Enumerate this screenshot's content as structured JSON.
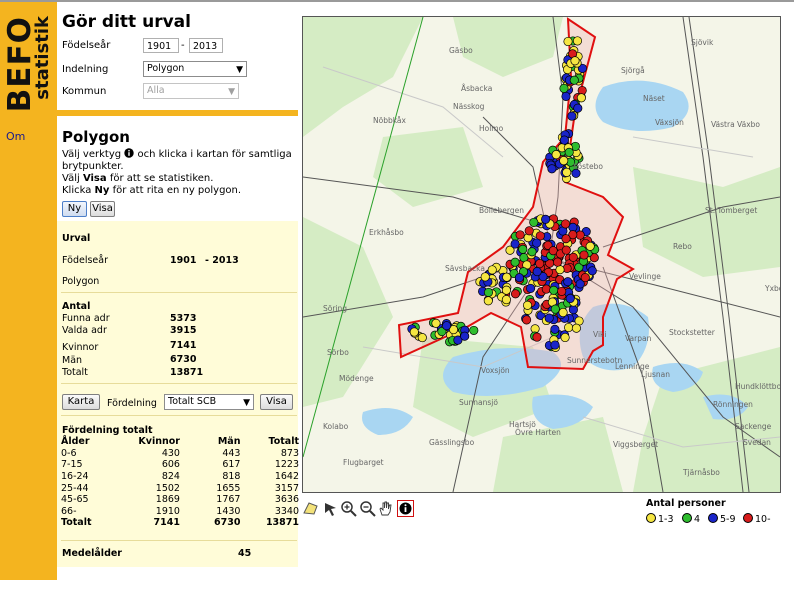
{
  "brand": {
    "main": "BEFO",
    "sub": "statistik"
  },
  "nav": {
    "om": "Om"
  },
  "selection_form": {
    "title": "Gör ditt urval",
    "birth_year_label": "Födelseår",
    "birth_from": "1901",
    "birth_to": "2013",
    "dash": "-",
    "division_label": "Indelning",
    "division_value": "Polygon",
    "municipality_label": "Kommun",
    "municipality_value": "Alla"
  },
  "polygon": {
    "title": "Polygon",
    "line1_pre": "Välj verktyg",
    "line1_post": "och klicka i kartan för samtliga brytpunkter.",
    "line2_pre": "Välj",
    "line2_bold": "Visa",
    "line2_post": "för att se statistiken.",
    "line3_pre": "Klicka",
    "line3_bold": "Ny",
    "line3_post": "för att rita en ny polygon.",
    "btn_new": "Ny",
    "btn_show": "Visa"
  },
  "stats": {
    "urval_heading": "Urval",
    "birth_label": "Födelseår",
    "birth_from": "1901",
    "birth_to": "- 2013",
    "division": "Polygon",
    "antal_heading": "Antal",
    "rows": [
      {
        "label": "Funna adr",
        "value": "5373"
      },
      {
        "label": "Valda adr",
        "value": "3915"
      },
      {
        "label": "Kvinnor",
        "value": "7141"
      },
      {
        "label": "Män",
        "value": "6730"
      },
      {
        "label": "Totalt",
        "value": "13871"
      }
    ],
    "karta_button": "Karta",
    "fordelning_label": "Fördelning",
    "fordelning_value": "Totalt SCB",
    "visa_button": "Visa"
  },
  "distribution": {
    "heading": "Fördelning totalt",
    "columns": [
      "Ålder",
      "Kvinnor",
      "Män",
      "Totalt"
    ],
    "rows": [
      [
        "0-6",
        "430",
        "443",
        "873"
      ],
      [
        "7-15",
        "606",
        "617",
        "1223"
      ],
      [
        "16-24",
        "824",
        "818",
        "1642"
      ],
      [
        "25-44",
        "1502",
        "1655",
        "3157"
      ],
      [
        "45-65",
        "1869",
        "1767",
        "3636"
      ],
      [
        "66-",
        "1910",
        "1430",
        "3340"
      ]
    ],
    "total": [
      "Totalt",
      "7141",
      "6730",
      "13871"
    ],
    "median_label": "Medelålder",
    "median_value": "45"
  },
  "map": {
    "places": [
      "Gäsbo",
      "Sjövik",
      "Sjörgå",
      "Åsbacka",
      "Näset",
      "Nässkog",
      "Nöbbkåx",
      "Holmo",
      "Växsjön",
      "Västra Växbo",
      "Köstebo",
      "Bollebergen",
      "Erkhåsbo",
      "St. Tomberget",
      "Sävsbacka",
      "Rebo",
      "Vevlinge",
      "Söring",
      "Stockstetter",
      "Yxbo",
      "Sörbo",
      "Varpan",
      "Viki",
      "Mödenge",
      "Sunnerstebotn",
      "Lenninge",
      "Voxsjön",
      "Ljusnan",
      "Hundklöttbo",
      "Sunnansjö",
      "Hartsjö",
      "Övre Harten",
      "Sackenge",
      "Gässlingsbo",
      "Kolabo",
      "Svedan",
      "Flugbarget",
      "Viggsberget",
      "Tjärnåsbo",
      "Rönningen"
    ]
  },
  "tools": [
    "polygon-draw-icon",
    "pan-icon",
    "zoom-in-icon",
    "zoom-out-icon",
    "hand-icon",
    "info-icon"
  ],
  "legend": {
    "title": "Antal personer",
    "items": [
      {
        "label": "1-3",
        "color": "#f5e642"
      },
      {
        "label": "4",
        "color": "#2ebd2e"
      },
      {
        "label": "5-9",
        "color": "#1a24c9"
      },
      {
        "label": "10-",
        "color": "#d81c1c"
      }
    ]
  }
}
